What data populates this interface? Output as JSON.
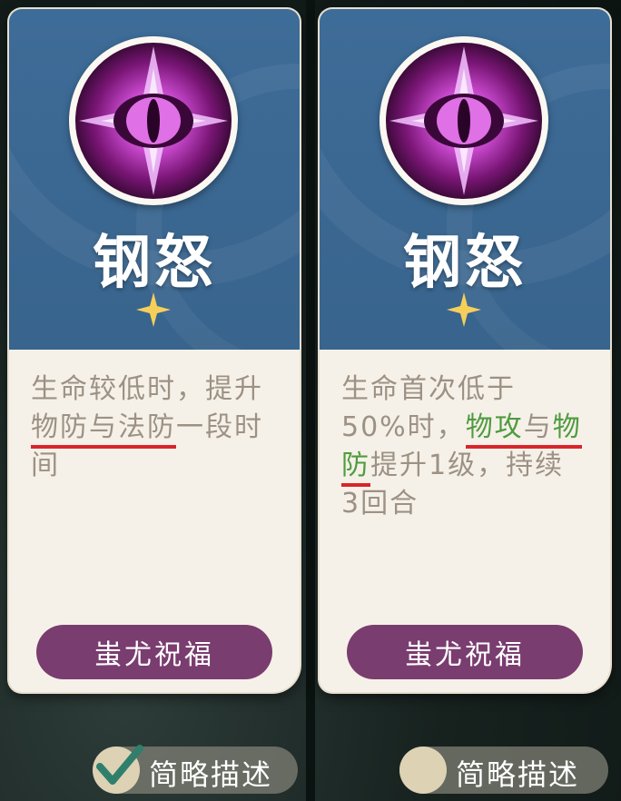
{
  "cards": [
    {
      "skill_name": "钢怒",
      "description": {
        "line1": "生命较低时，提升",
        "highlight": "物防与法防",
        "after_highlight": "一段时",
        "line3": "间"
      },
      "button_label": "蚩尤祝福"
    },
    {
      "skill_name": "钢怒",
      "description": {
        "line1": "生命首次低于",
        "line2_prefix": "50%时，",
        "hl1": "物攻",
        "mid": "与",
        "hl2a": "物",
        "hl2b": "防",
        "after": "提升1级，持续",
        "line4": "3回合"
      },
      "button_label": "蚩尤祝福"
    }
  ],
  "toggles": [
    {
      "label": "简略描述",
      "checked": true
    },
    {
      "label": "简略描述",
      "checked": false
    }
  ],
  "colors": {
    "card_top": "#3b6894",
    "card_body": "#f6f1e8",
    "button": "#7a3d70",
    "highlight_green": "#4f9b40",
    "underline_red": "#d8252b"
  },
  "icons": [
    "demon-eye-icon",
    "star-icon",
    "checkmark-icon"
  ]
}
